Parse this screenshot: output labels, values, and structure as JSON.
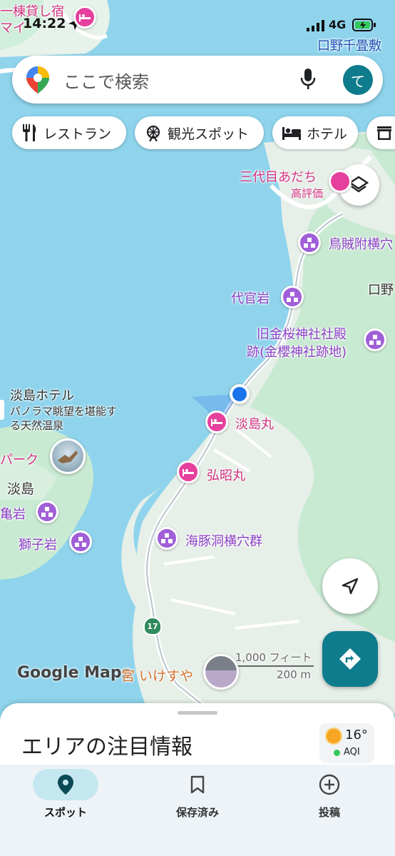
{
  "status_bar": {
    "time": "14:22",
    "network": "4G"
  },
  "search": {
    "placeholder": "ここで検索",
    "avatar_initial": "て"
  },
  "chips": [
    {
      "label": "レストラン",
      "icon": "restaurant-icon"
    },
    {
      "label": "観光スポット",
      "icon": "attraction-icon"
    },
    {
      "label": "ホテル",
      "icon": "hotel-icon"
    },
    {
      "label": "",
      "icon": "store-icon"
    }
  ],
  "map_labels": {
    "top_hotel": "一棟貸し宿",
    "top_hotel_2": "マイ",
    "kuchinosenjojiki": "口野千畳敷",
    "sandaime": "三代目あだち",
    "sandaime_sub": "高評価",
    "karasuzuke": "鳥賊附横穴",
    "daikanwa": "代官岩",
    "kuchino": "口野",
    "kyukinsakura_1": "旧金桜神社社殿",
    "kyukinsakura_2": "跡(金櫻神社跡地)",
    "awashima_hotel": "淡島ホテル",
    "awashima_hotel_sub1": "パノラマ眺望を堪能す",
    "awashima_hotel_sub2": "る天然温泉",
    "awashimamaru": "淡島丸",
    "park": "パーク",
    "awashima": "淡島",
    "kokumaru": "弘昭丸",
    "kameiwa": "亀岩",
    "shishiiwa": "獅子岩",
    "iruka": "海豚洞横穴群",
    "route_no": "17",
    "ikesuya": "宮 いけすや",
    "scale_ft": "1,000 フィート",
    "scale_m": "200 m",
    "google_logo": "Google Maps"
  },
  "sheet": {
    "title": "エリアの注目情報",
    "temperature": "16°",
    "aqi_label": "AQI"
  },
  "bottom_nav": [
    {
      "label": "スポット",
      "icon": "place-icon",
      "active": true
    },
    {
      "label": "保存済み",
      "icon": "bookmark-icon",
      "active": false
    },
    {
      "label": "投稿",
      "icon": "add-circle-icon",
      "active": false
    }
  ],
  "colors": {
    "water": "#8fd4ec",
    "land": "#e6f2ea",
    "green": "#c9ead2",
    "accent": "#0e7c8c"
  }
}
